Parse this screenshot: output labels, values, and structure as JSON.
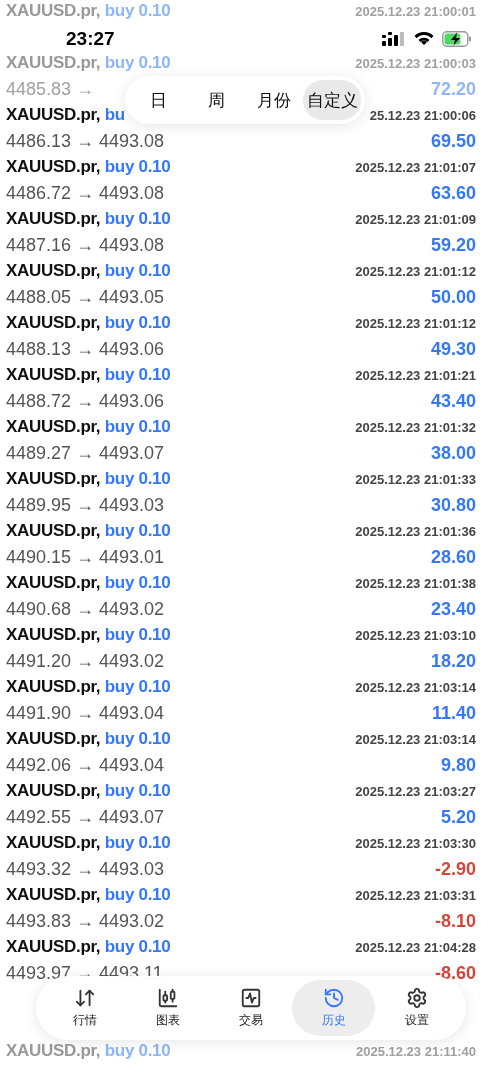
{
  "status_bar": {
    "time": "23:27"
  },
  "period_tabs": [
    {
      "label": "日",
      "selected": false
    },
    {
      "label": "周",
      "selected": false
    },
    {
      "label": "月份",
      "selected": false
    },
    {
      "label": "自定义",
      "selected": true
    }
  ],
  "trades": [
    {
      "symbol": "XAUUSD.pr,",
      "side": "buy 0.10",
      "time": "2025.12.23 21:00:01",
      "dimmed": true
    },
    {
      "symbol": "XAUUSD.pr,",
      "side": "buy 0.10",
      "time": "2025.12.23 21:00:03",
      "prices": "4485.83 →",
      "value": "72.20",
      "color": "#8fb6f6",
      "dimmed": true
    },
    {
      "symbol": "XAUUSD.pr,",
      "side": "bu",
      "time": "25.12.23 21:00:06",
      "prices": "4486.13 → 4493.08",
      "value": "69.50",
      "color": "#3478f6",
      "dimmed": false
    },
    {
      "symbol": "XAUUSD.pr,",
      "side": "buy 0.10",
      "time": "2025.12.23 21:01:07",
      "prices": "4486.72 → 4493.08",
      "value": "63.60",
      "color": "#3478f6",
      "dimmed": false
    },
    {
      "symbol": "XAUUSD.pr,",
      "side": "buy 0.10",
      "time": "2025.12.23 21:01:09",
      "prices": "4487.16 → 4493.08",
      "value": "59.20",
      "color": "#3478f6",
      "dimmed": false
    },
    {
      "symbol": "XAUUSD.pr,",
      "side": "buy 0.10",
      "time": "2025.12.23 21:01:12",
      "prices": "4488.05 → 4493.05",
      "value": "50.00",
      "color": "#3478f6",
      "dimmed": false
    },
    {
      "symbol": "XAUUSD.pr,",
      "side": "buy 0.10",
      "time": "2025.12.23 21:01:12",
      "prices": "4488.13 → 4493.06",
      "value": "49.30",
      "color": "#3478f6",
      "dimmed": false
    },
    {
      "symbol": "XAUUSD.pr,",
      "side": "buy 0.10",
      "time": "2025.12.23 21:01:21",
      "prices": "4488.72 → 4493.06",
      "value": "43.40",
      "color": "#3478f6",
      "dimmed": false
    },
    {
      "symbol": "XAUUSD.pr,",
      "side": "buy 0.10",
      "time": "2025.12.23 21:01:32",
      "prices": "4489.27 → 4493.07",
      "value": "38.00",
      "color": "#3478f6",
      "dimmed": false
    },
    {
      "symbol": "XAUUSD.pr,",
      "side": "buy 0.10",
      "time": "2025.12.23 21:01:33",
      "prices": "4489.95 → 4493.03",
      "value": "30.80",
      "color": "#3478f6",
      "dimmed": false
    },
    {
      "symbol": "XAUUSD.pr,",
      "side": "buy 0.10",
      "time": "2025.12.23 21:01:36",
      "prices": "4490.15 → 4493.01",
      "value": "28.60",
      "color": "#3478f6",
      "dimmed": false
    },
    {
      "symbol": "XAUUSD.pr,",
      "side": "buy 0.10",
      "time": "2025.12.23 21:01:38",
      "prices": "4490.68 → 4493.02",
      "value": "23.40",
      "color": "#3478f6",
      "dimmed": false
    },
    {
      "symbol": "XAUUSD.pr,",
      "side": "buy 0.10",
      "time": "2025.12.23 21:03:10",
      "prices": "4491.20 → 4493.02",
      "value": "18.20",
      "color": "#3478f6",
      "dimmed": false
    },
    {
      "symbol": "XAUUSD.pr,",
      "side": "buy 0.10",
      "time": "2025.12.23 21:03:14",
      "prices": "4491.90 → 4493.04",
      "value": "11.40",
      "color": "#3478f6",
      "dimmed": false
    },
    {
      "symbol": "XAUUSD.pr,",
      "side": "buy 0.10",
      "time": "2025.12.23 21:03:14",
      "prices": "4492.06 → 4493.04",
      "value": "9.80",
      "color": "#3478f6",
      "dimmed": false
    },
    {
      "symbol": "XAUUSD.pr,",
      "side": "buy 0.10",
      "time": "2025.12.23 21:03:27",
      "prices": "4492.55 → 4493.07",
      "value": "5.20",
      "color": "#3478f6",
      "dimmed": false
    },
    {
      "symbol": "XAUUSD.pr,",
      "side": "buy 0.10",
      "time": "2025.12.23 21:03:30",
      "prices": "4493.32 → 4493.03",
      "value": "-2.90",
      "color": "#d2473b",
      "dimmed": false
    },
    {
      "symbol": "XAUUSD.pr,",
      "side": "buy 0.10",
      "time": "2025.12.23 21:03:31",
      "prices": "4493.83 → 4493.02",
      "value": "-8.10",
      "color": "#d2473b",
      "dimmed": false
    },
    {
      "symbol": "XAUUSD.pr,",
      "side": "buy 0.10",
      "time": "2025.12.23 21:04:28",
      "prices": "4493.97 → 4493.11",
      "value": "-8.60",
      "color": "#d2473b",
      "dimmed": false
    }
  ],
  "tab_bar": [
    {
      "label": "行情",
      "selected": false
    },
    {
      "label": "图表",
      "selected": false
    },
    {
      "label": "交易",
      "selected": false
    },
    {
      "label": "历史",
      "selected": true
    },
    {
      "label": "设置",
      "selected": false
    }
  ],
  "trades_below_bar": [
    {
      "symbol": "XAUUSD.pr,",
      "side": "buy 0.10",
      "time": "2025.12.23 21:11:40",
      "dimmed": true
    }
  ]
}
